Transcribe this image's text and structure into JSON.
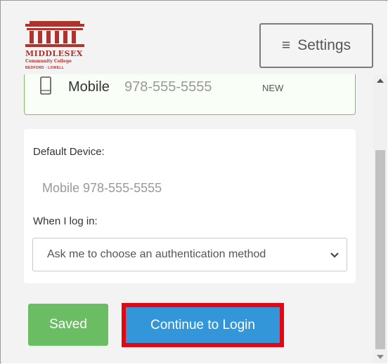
{
  "header": {
    "logo": {
      "name": "MIDDLESEX",
      "subtitle": "Community College",
      "locations": "BEDFORD · LOWELL",
      "icon": "building-columns-icon",
      "color": "#b0322d"
    },
    "settings_button": {
      "icon": "hamburger-icon",
      "label": "Settings"
    }
  },
  "device": {
    "icon": "phone-icon",
    "type": "Mobile",
    "number": "978-555-5555",
    "badge": "NEW",
    "border_color": "#7fbd6a"
  },
  "preferences": {
    "default_device_label": "Default Device:",
    "default_device_value": "Mobile 978-555-5555",
    "when_login_label": "When I log in:",
    "login_option": {
      "selected": "Ask me to choose an authentication method",
      "icon": "chevron-down-icon"
    }
  },
  "actions": {
    "saved_label": "Saved",
    "continue_label": "Continue to Login",
    "saved_color": "#6bbd63",
    "continue_color": "#3296d8",
    "highlight_color": "#e30613"
  }
}
